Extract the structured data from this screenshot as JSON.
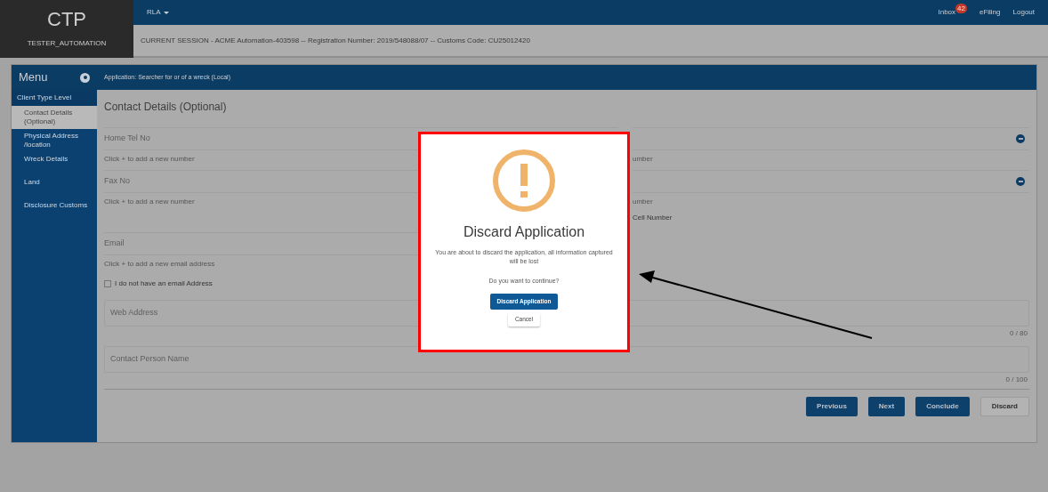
{
  "header": {
    "logo": "CTP",
    "username": "TESTER_AUTOMATION",
    "menu": "RLA",
    "links": [
      {
        "label": "Inbox",
        "badge": "42"
      },
      {
        "label": "eFiling"
      },
      {
        "label": "Logout"
      }
    ],
    "session": "CURRENT SESSION - ACME Automation-403598 -- Registration Number: 2019/548088/07 -- Customs Code: CU25012420"
  },
  "menu": {
    "title": "Menu",
    "application": "Application: Searcher for or of a wreck (Local)",
    "section": "Client Type Level",
    "items": [
      {
        "label": "Contact Details (Optional)",
        "selected": true
      },
      {
        "label": "Physical Address /location",
        "selected": false
      },
      {
        "label": "Wreck Details",
        "selected": false
      },
      {
        "label": "Land",
        "selected": false
      },
      {
        "label": "Disclosure Customs",
        "selected": false
      }
    ]
  },
  "form": {
    "title": "Contact Details (Optional)",
    "phone_rows": [
      {
        "label": "Home Tel No",
        "hint": "Click + to add a new number",
        "right_hint": "umber"
      },
      {
        "label": "Fax No",
        "hint": "Click + to add a new number",
        "right_hint": "umber"
      }
    ],
    "cell_checkbox_label": "Cell Number",
    "email": {
      "label": "Email",
      "hint": "Click + to add a new email address"
    },
    "no_email": {
      "label": "I do not have an email Address",
      "checked": false
    },
    "text_fields": [
      {
        "placeholder": "Web Address",
        "counter": "0 / 80"
      },
      {
        "placeholder": "Contact Person Name",
        "counter": "0 / 100"
      }
    ],
    "buttons": [
      {
        "label": "Previous",
        "kind": "primary"
      },
      {
        "label": "Next",
        "kind": "primary"
      },
      {
        "label": "Conclude",
        "kind": "primary"
      },
      {
        "label": "Discard",
        "kind": "secondary"
      }
    ]
  },
  "dialog": {
    "title": "Discard Application",
    "message": "You are about to discard the application, all information captured will be lost",
    "question": "Do you want to continue?",
    "confirm": "Discard Application",
    "cancel": "Cancel"
  }
}
